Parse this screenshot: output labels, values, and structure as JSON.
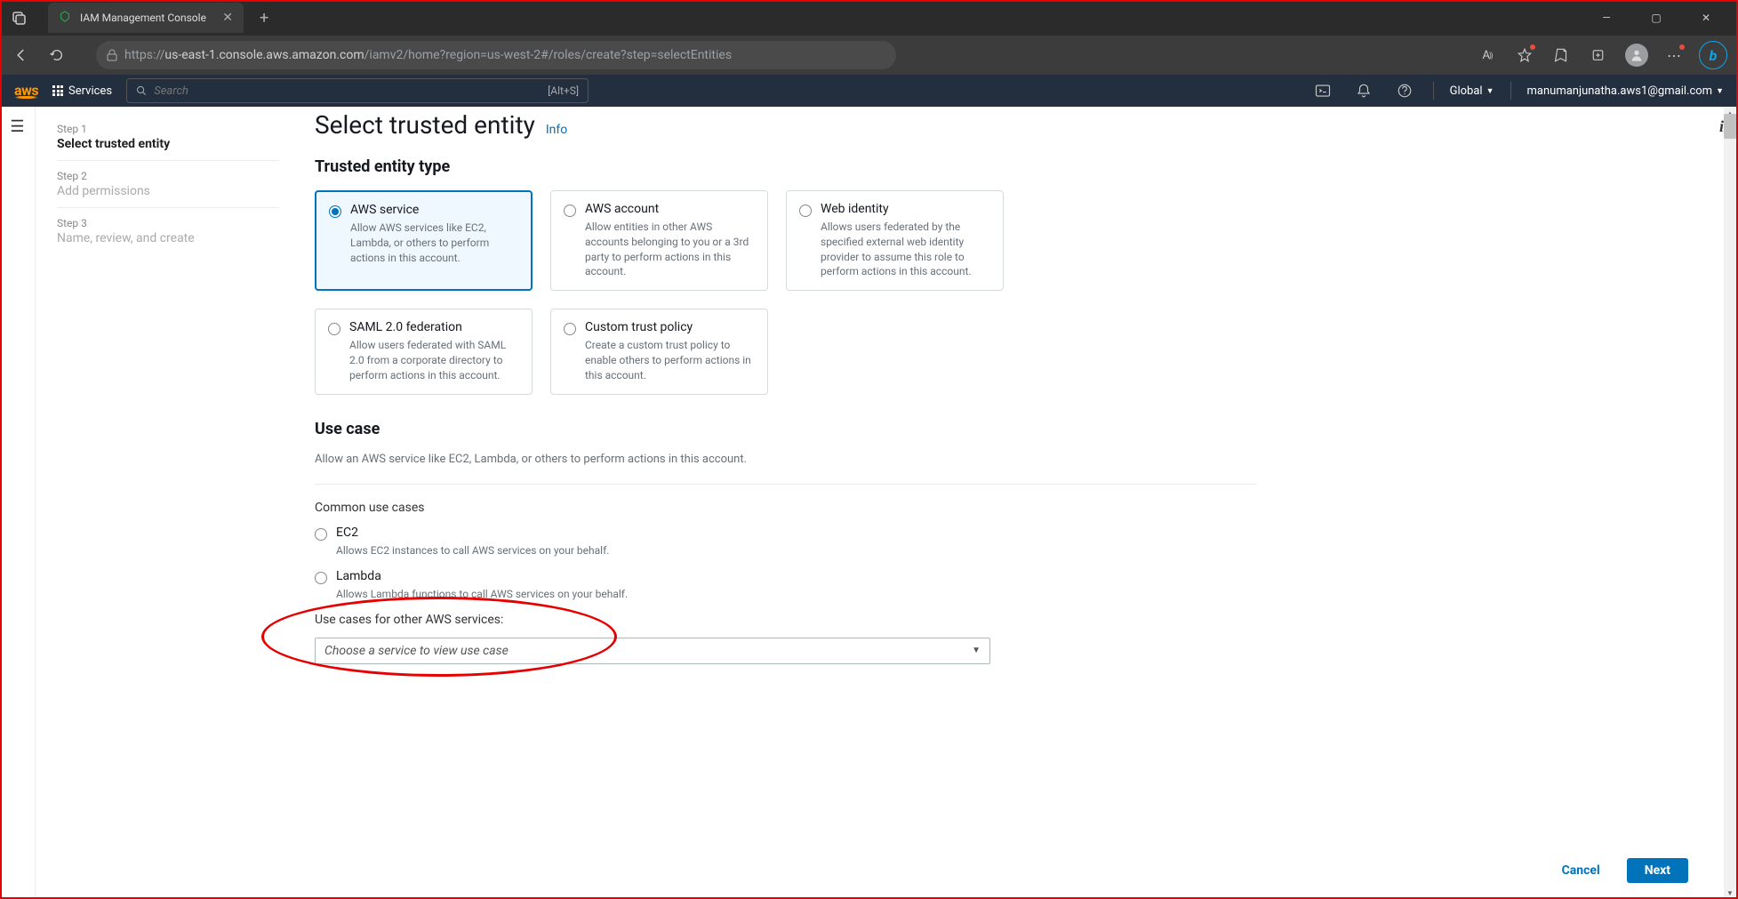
{
  "browser": {
    "tab_title": "IAM Management Console",
    "url_prefix": "https://",
    "url_domain": "us-east-1.console.aws.amazon.com",
    "url_path": "/iamv2/home?region=us-west-2#/roles/create?step=selectEntities"
  },
  "aws_header": {
    "services_label": "Services",
    "search_placeholder": "Search",
    "search_shortcut": "[Alt+S]",
    "region": "Global",
    "user": "manumanjunatha.aws1@gmail.com"
  },
  "wizard": {
    "step1_num": "Step 1",
    "step1_label": "Select trusted entity",
    "step2_num": "Step 2",
    "step2_label": "Add permissions",
    "step3_num": "Step 3",
    "step3_label": "Name, review, and create"
  },
  "page": {
    "title": "Select trusted entity",
    "info": "Info",
    "trusted_entity_heading": "Trusted entity type",
    "use_case_heading": "Use case",
    "use_case_desc": "Allow an AWS service like EC2, Lambda, or others to perform actions in this account.",
    "common_use_cases": "Common use cases",
    "other_services_label": "Use cases for other AWS services:",
    "select_placeholder": "Choose a service to view use case",
    "cancel": "Cancel",
    "next": "Next"
  },
  "entities": {
    "aws_service": {
      "title": "AWS service",
      "desc": "Allow AWS services like EC2, Lambda, or others to perform actions in this account."
    },
    "aws_account": {
      "title": "AWS account",
      "desc": "Allow entities in other AWS accounts belonging to you or a 3rd party to perform actions in this account."
    },
    "web_identity": {
      "title": "Web identity",
      "desc": "Allows users federated by the specified external web identity provider to assume this role to perform actions in this account."
    },
    "saml": {
      "title": "SAML 2.0 federation",
      "desc": "Allow users federated with SAML 2.0 from a corporate directory to perform actions in this account."
    },
    "custom": {
      "title": "Custom trust policy",
      "desc": "Create a custom trust policy to enable others to perform actions in this account."
    }
  },
  "common_cases": {
    "ec2": {
      "title": "EC2",
      "desc": "Allows EC2 instances to call AWS services on your behalf."
    },
    "lambda": {
      "title": "Lambda",
      "desc": "Allows Lambda functions to call AWS services on your behalf."
    }
  }
}
